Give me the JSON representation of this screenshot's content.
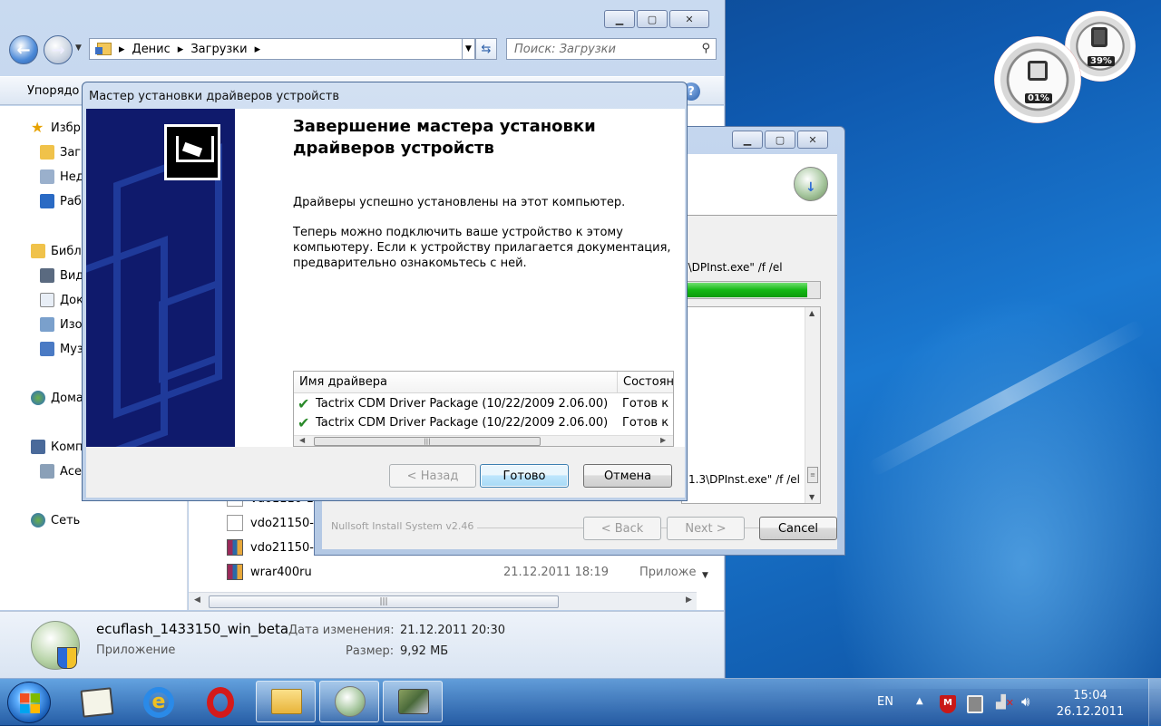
{
  "explorer": {
    "breadcrumb": [
      "Денис",
      "Загрузки"
    ],
    "search_placeholder": "Поиск: Загрузки",
    "organize_label": "Упорядо",
    "nav_items": [
      {
        "label": "Избр",
        "type": "favorites"
      },
      {
        "label": "Загр",
        "type": "downloads"
      },
      {
        "label": "Нед",
        "type": "recent"
      },
      {
        "label": "Раб",
        "type": "desktop"
      },
      {
        "label": "Библ",
        "type": "libraries"
      },
      {
        "label": "Вид",
        "type": "video"
      },
      {
        "label": "Док",
        "type": "documents"
      },
      {
        "label": "Изо",
        "type": "pictures"
      },
      {
        "label": "Муз",
        "type": "music"
      },
      {
        "label": "Дома",
        "type": "homegroup"
      },
      {
        "label": "Комп",
        "type": "computer"
      },
      {
        "label": "Асе",
        "type": "drive"
      },
      {
        "label": "Сеть",
        "type": "network"
      }
    ],
    "files": [
      {
        "name": "vdo1110-1",
        "date": "",
        "type": ""
      },
      {
        "name": "vdo21150-",
        "date": "",
        "type": ""
      },
      {
        "name": "vdo21150-",
        "date": "",
        "type": ""
      },
      {
        "name": "wrar400ru",
        "date": "21.12.2011 18:19",
        "type": "Приложе"
      }
    ],
    "details": {
      "name": "ecuflash_1433150_win_beta",
      "kind": "Приложение",
      "modified_label": "Дата изменения:",
      "modified_value": "21.12.2011 20:30",
      "size_label": "Размер:",
      "size_value": "9,92 МБ"
    }
  },
  "nsis": {
    "cmd_line_1": "3\\DPInst.exe\" /f /el",
    "cmd_line_2": "1.3\\DPInst.exe\" /f /el",
    "progress": 0.9,
    "brand": "Nullsoft Install System v2.46",
    "buttons": {
      "back": "< Back",
      "next": "Next >",
      "cancel": "Cancel"
    }
  },
  "wizard": {
    "title": "Мастер установки драйверов устройств",
    "heading": "Завершение мастера установки драйверов устройств",
    "p1": "Драйверы успешно установлены на этот компьютер.",
    "p2": "Теперь можно подключить ваше устройство к этому компьютеру. Если к устройству прилагается документация, предварительно ознакомьтесь с ней.",
    "columns": [
      "Имя драйвера",
      "Состоян"
    ],
    "drivers": [
      {
        "name": "Tactrix CDM Driver Package (10/22/2009 2.06.00)",
        "status": "Готов к з"
      },
      {
        "name": "Tactrix CDM Driver Package (10/22/2009 2.06.00)",
        "status": "Готов к з"
      }
    ],
    "buttons": {
      "back": "< Назад",
      "finish": "Готово",
      "cancel": "Отмена"
    }
  },
  "gadgets": {
    "cpu": "01%",
    "memory": "39%"
  },
  "taskbar": {
    "language": "EN",
    "time": "15:04",
    "date": "26.12.2011",
    "apps": [
      "start",
      "notepad",
      "internet-explorer",
      "opera",
      "explorer",
      "installer",
      "device-manager"
    ]
  }
}
